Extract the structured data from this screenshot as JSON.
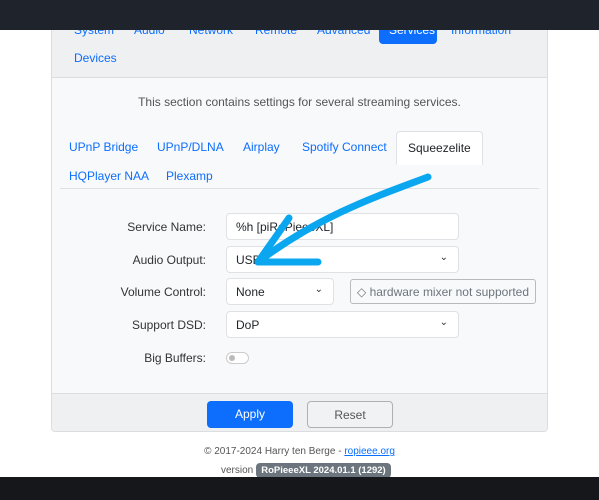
{
  "nav_tabs": [
    "System",
    "Audio",
    "Network",
    "Remote",
    "Advanced",
    "Services",
    "Information",
    "Devices"
  ],
  "active_nav": "Services",
  "description": "This section contains settings for several streaming services.",
  "service_tabs": [
    "UPnP Bridge",
    "UPnP/DLNA",
    "Airplay",
    "Spotify Connect",
    "Squeezelite",
    "HQPlayer NAA",
    "Plexamp"
  ],
  "active_service": "Squeezelite",
  "form": {
    "service_name": {
      "label": "Service Name:",
      "value": "%h [piRoPieeeXL]"
    },
    "audio_output": {
      "label": "Audio Output:",
      "value": "USB"
    },
    "volume_control": {
      "label": "Volume Control:",
      "value": "None",
      "hint": "hardware mixer not supported",
      "hint_icon": "warning-diamond-icon"
    },
    "support_dsd": {
      "label": "Support DSD:",
      "value": "DoP"
    },
    "big_buffers": {
      "label": "Big Buffers:",
      "enabled": false
    }
  },
  "buttons": {
    "apply": "Apply",
    "reset": "Reset"
  },
  "footer": {
    "copyright": "© 2017-2024 Harry ten Berge - ",
    "link": "ropieee.org",
    "version_label": "version",
    "version": "RoPieeeXL 2024.01.1 (1292)"
  },
  "annotation_color": "#0aa7f0",
  "accent": "#0d6efd"
}
